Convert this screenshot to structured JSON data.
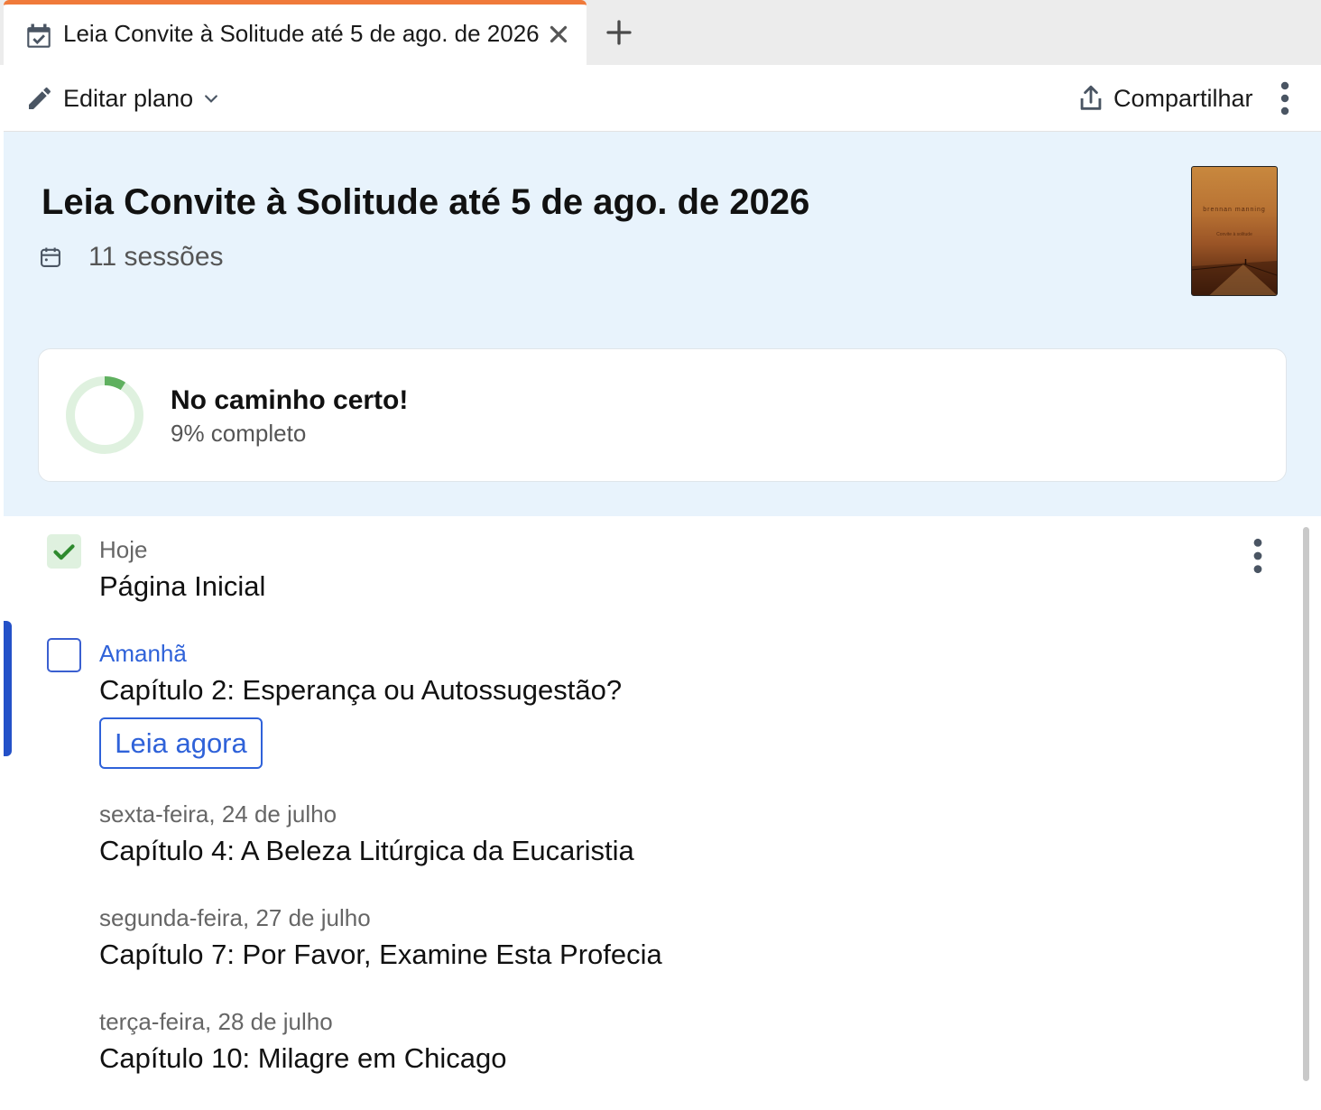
{
  "tab": {
    "title": "Leia Convite à Solitude até 5 de ago. de 2026",
    "icon": "calendar-check-icon",
    "close_icon": "close-icon",
    "new_tab_icon": "plus-icon",
    "accent_color": "#f07a3a"
  },
  "toolbar": {
    "edit_label": "Editar plano",
    "share_label": "Compartilhar"
  },
  "header": {
    "title": "Leia Convite à Solitude até 5 de ago. de 2026",
    "sessions": "11 sessões",
    "cover": {
      "author": "brennan manning",
      "subtitle": "Convite à solitude"
    }
  },
  "progress": {
    "status": "No caminho certo!",
    "percent_label": "9% completo",
    "percent": 9,
    "color": "#5fb05f",
    "track_color": "#dff1df"
  },
  "sessions": [
    {
      "day": "Hoje",
      "chapter": "Página Inicial",
      "done": true
    },
    {
      "day": "Amanhã",
      "chapter": "Capítulo 2: Esperança ou Autossugestão?",
      "done": false,
      "action": "Leia agora"
    },
    {
      "day": "sexta-feira, 24 de julho",
      "chapter": "Capítulo 4: A Beleza Litúrgica da Eucaristia"
    },
    {
      "day": "segunda-feira, 27 de julho",
      "chapter": "Capítulo 7: Por Favor, Examine Esta Profecia"
    },
    {
      "day": "terça-feira, 28 de julho",
      "chapter": "Capítulo 10: Milagre em Chicago"
    }
  ],
  "colors": {
    "header_bg": "#e8f3fc",
    "link_blue": "#2f62d9",
    "active_bar": "#2451c8"
  }
}
